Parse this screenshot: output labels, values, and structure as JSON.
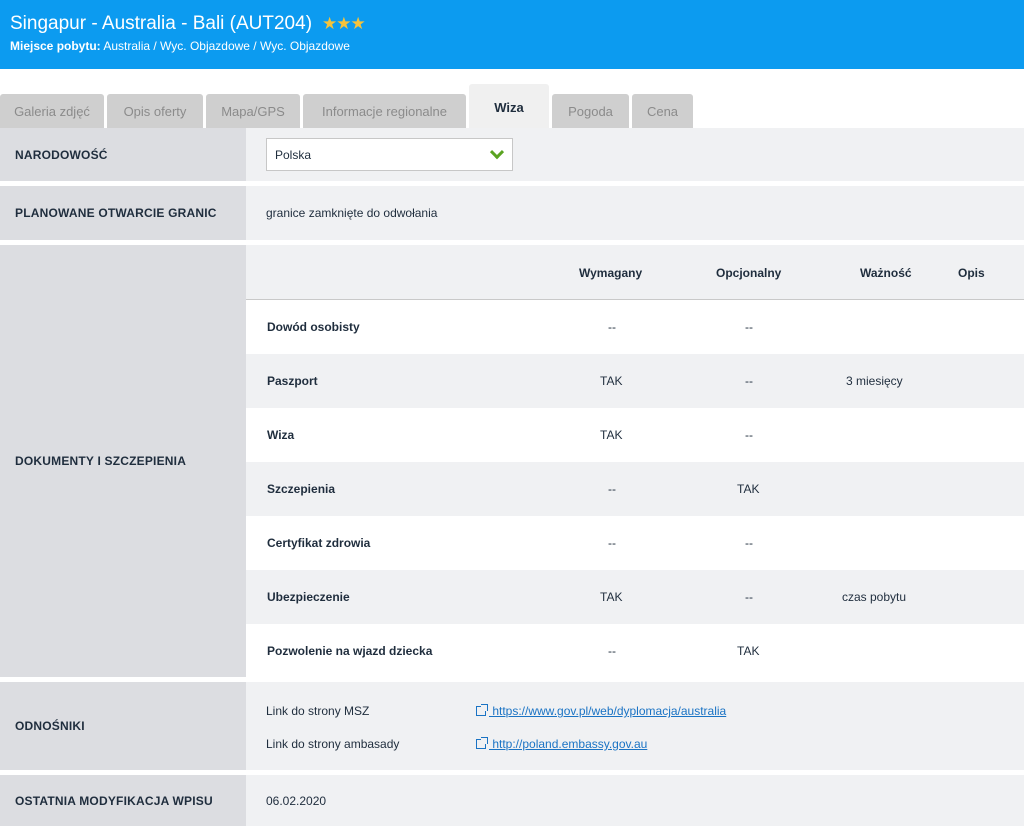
{
  "header": {
    "title": "Singapur - Australia - Bali  (AUT204)",
    "stars": "★★★",
    "subtitle_label": "Miejsce pobytu:",
    "subtitle_value": " Australia / Wyc. Objazdowe / Wyc. Objazdowe"
  },
  "tabs": [
    {
      "label": "Galeria zdjęć"
    },
    {
      "label": "Opis oferty"
    },
    {
      "label": "Mapa/GPS"
    },
    {
      "label": "Informacje regionalne"
    },
    {
      "label": "Wiza"
    },
    {
      "label": "Pogoda"
    },
    {
      "label": "Cena"
    }
  ],
  "nationality": {
    "label": "NARODOWOŚĆ",
    "selected": "Polska"
  },
  "borders": {
    "label": "PLANOWANE OTWARCIE GRANIC",
    "value": "granice zamknięte do odwołania"
  },
  "documents": {
    "label": "DOKUMENTY I SZCZEPIENIA",
    "columns": [
      "Wymagany",
      "Opcjonalny",
      "Ważność",
      "Opis"
    ],
    "rows": [
      {
        "name": "Dowód osobisty",
        "required": "--",
        "optional": "--",
        "validity": ""
      },
      {
        "name": "Paszport",
        "required": "TAK",
        "optional": "--",
        "validity": "3 miesięcy"
      },
      {
        "name": "Wiza",
        "required": "TAK",
        "optional": "--",
        "validity": ""
      },
      {
        "name": "Szczepienia",
        "required": "--",
        "optional": "TAK",
        "validity": ""
      },
      {
        "name": "Certyfikat zdrowia",
        "required": "--",
        "optional": "--",
        "validity": ""
      },
      {
        "name": "Ubezpieczenie",
        "required": "TAK",
        "optional": "--",
        "validity": "czas pobytu"
      },
      {
        "name": "Pozwolenie na wjazd dziecka",
        "required": "--",
        "optional": "TAK",
        "validity": ""
      }
    ]
  },
  "links": {
    "label": "ODNOŚNIKI",
    "items": [
      {
        "text": "Link do strony MSZ",
        "url": " https://www.gov.pl/web/dyplomacja/australia"
      },
      {
        "text": "Link do strony ambasady",
        "url": " http://poland.embassy.gov.au"
      }
    ]
  },
  "modified": {
    "label": "OSTATNIA MODYFIKACJA WPISU",
    "value": "06.02.2020"
  },
  "colors": {
    "header_bg": "#0c9bf0",
    "stars": "#f5c33b",
    "chevron": "#5aa321",
    "link": "#1a73c4"
  }
}
